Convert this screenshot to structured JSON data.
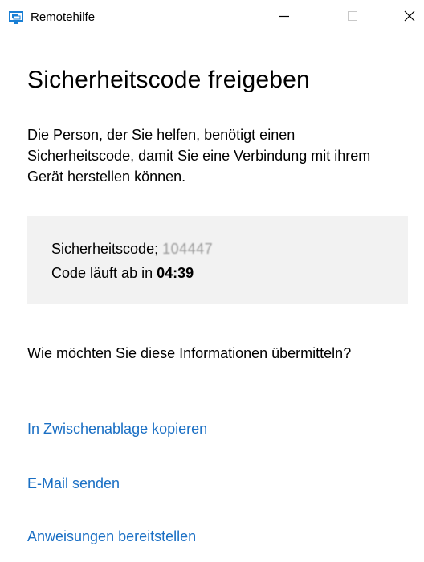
{
  "window": {
    "title": "Remotehilfe",
    "app_icon": "remote-assistance-icon",
    "controls": {
      "minimize_icon": "minimize-icon",
      "maximize_icon": "maximize-icon",
      "close_icon": "close-icon"
    }
  },
  "main": {
    "heading": "Sicherheitscode freigeben",
    "description": "Die Person, der Sie helfen, benötigt einen Sicherheitscode, damit Sie eine Verbindung mit ihrem Gerät herstellen können.",
    "code_box": {
      "code_label": "Sicherheitscode;",
      "code_value": "104447",
      "expiry_label": "Code läuft ab in",
      "expiry_value": "04:39"
    },
    "question": "Wie möchten Sie diese Informationen übermitteln?",
    "links": {
      "copy": "In Zwischenablage kopieren",
      "email": "E-Mail senden",
      "instructions": "Anweisungen bereitstellen"
    }
  },
  "colors": {
    "link": "#1a6fc4",
    "code_box_bg": "#f2f2f2",
    "app_icon_blue": "#1a7fd4"
  }
}
